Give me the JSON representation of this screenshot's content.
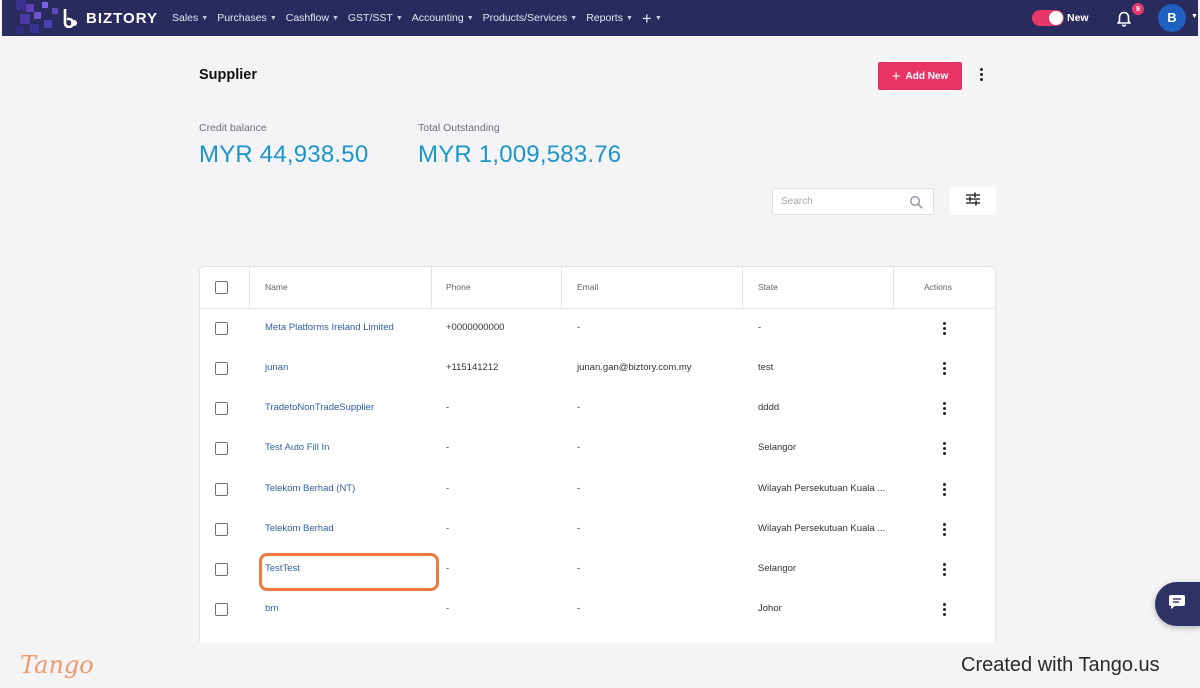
{
  "app": {
    "name": "BIZTORY"
  },
  "nav": {
    "items": [
      {
        "label": "Sales"
      },
      {
        "label": "Purchases"
      },
      {
        "label": "Cashflow"
      },
      {
        "label": "GST/SST"
      },
      {
        "label": "Accounting"
      },
      {
        "label": "Products/Services"
      },
      {
        "label": "Reports"
      }
    ],
    "toggle_label": "New",
    "notification_count": "9",
    "avatar_initial": "B"
  },
  "page": {
    "title": "Supplier",
    "add_button_label": "Add New"
  },
  "stats": {
    "credit_balance_label": "Credit balance",
    "credit_balance_value": "MYR 44,938.50",
    "total_outstanding_label": "Total Outstanding",
    "total_outstanding_value": "MYR 1,009,583.76"
  },
  "search": {
    "placeholder": "Search"
  },
  "table": {
    "headers": {
      "name": "Name",
      "phone": "Phone",
      "email": "Email",
      "state": "State",
      "actions": "Actions"
    },
    "rows": [
      {
        "name": "Meta Platforms Ireland Limited",
        "phone": "+0000000000",
        "email": "-",
        "state": "-"
      },
      {
        "name": "junan",
        "phone": "+115141212",
        "email": "junan.gan@biztory.com.my",
        "state": "test"
      },
      {
        "name": "TradetoNonTradeSupplier",
        "phone": "-",
        "email": "-",
        "state": "dddd"
      },
      {
        "name": "Test Auto Fill In",
        "phone": "-",
        "email": "-",
        "state": "Selangor"
      },
      {
        "name": "Telekom Berhad (NT)",
        "phone": "-",
        "email": "-",
        "state": "Wilayah Persekutuan Kuala ..."
      },
      {
        "name": "Telekom Berhad",
        "phone": "-",
        "email": "-",
        "state": "Wilayah Persekutuan Kuala ..."
      },
      {
        "name": "TestTest",
        "phone": "-",
        "email": "-",
        "state": "Selangor"
      },
      {
        "name": "brn",
        "phone": "-",
        "email": "-",
        "state": "Johor"
      }
    ]
  },
  "footer": {
    "tango_logo": "Tango",
    "created_with": "Created with Tango.us"
  },
  "colors": {
    "nav_bg": "#292a5e",
    "accent_pink": "#ea3366",
    "stat_blue": "#1c96c9",
    "link_blue": "#2e5e9e",
    "highlight_orange": "#ee7a3e"
  }
}
